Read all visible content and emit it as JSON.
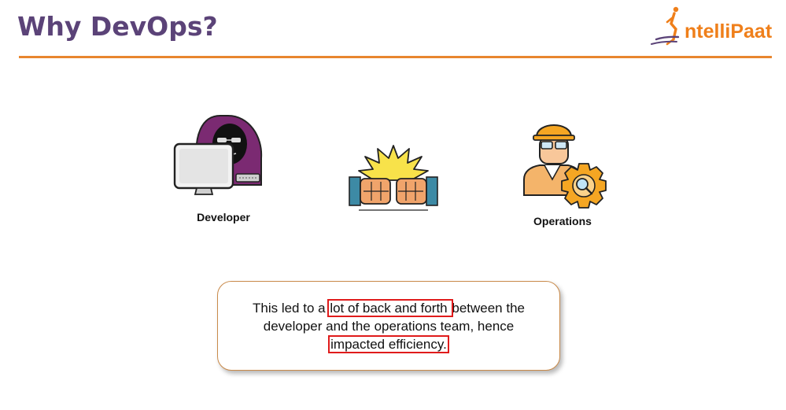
{
  "slide": {
    "title": "Why DevOps?",
    "logo": {
      "text": "ntelliPaat",
      "brand_color": "#ef7f1a",
      "icon": "running-person-logo-icon"
    },
    "accent_rule_color": "#e8862e",
    "title_color": "#5b4378"
  },
  "figures": {
    "developer": {
      "icon": "hooded-developer-at-computer-icon",
      "label": "Developer"
    },
    "conflict": {
      "icon": "clashing-fists-icon"
    },
    "operations": {
      "icon": "engineer-with-gear-icon",
      "label": "Operations"
    }
  },
  "callout": {
    "line1_before": "This led to a ",
    "line1_highlight": "lot of back and forth ",
    "line1_after": "between the",
    "line2": "developer and the operations team, hence",
    "line3_highlight": "impacted efficiency.",
    "highlight_color": "#e01b1b",
    "border_color": "#c98a4a"
  }
}
